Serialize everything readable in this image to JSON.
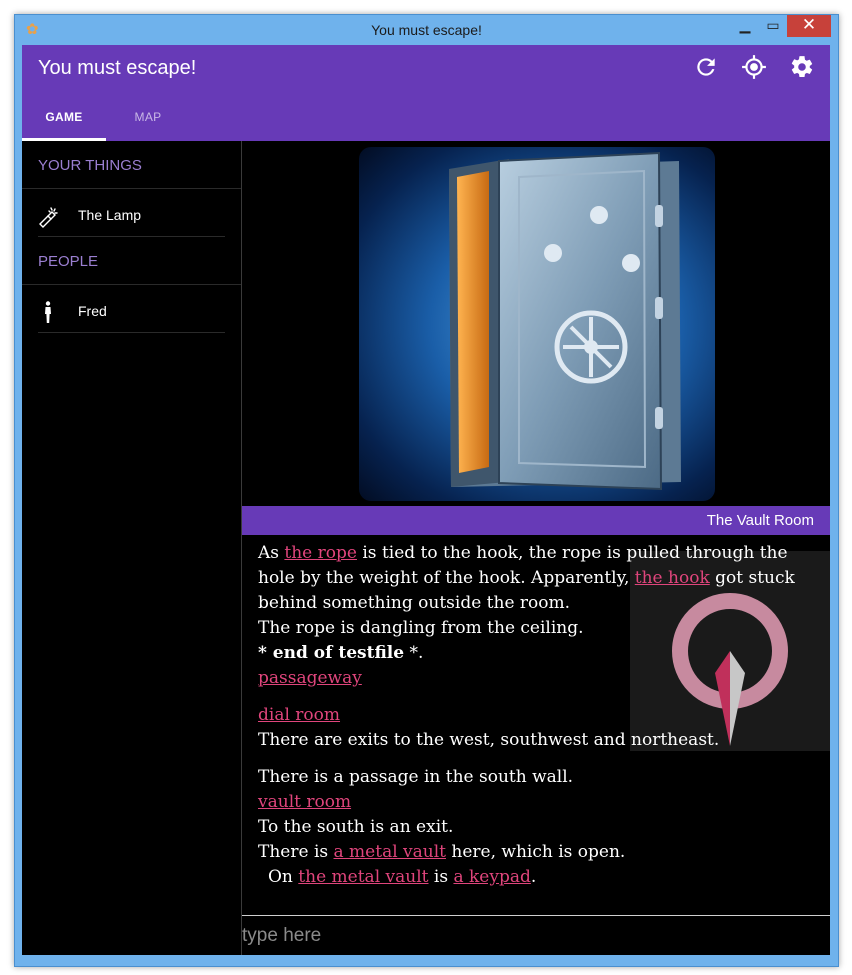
{
  "window": {
    "title": "You must escape!"
  },
  "appbar": {
    "title": "You must escape!"
  },
  "tabs": [
    {
      "label": "GAME"
    },
    {
      "label": "MAP"
    }
  ],
  "sidebar": {
    "things_header": "YOUR THINGS",
    "things": [
      {
        "label": "The Lamp",
        "icon": "flashlight-icon"
      }
    ],
    "people_header": "PEOPLE",
    "people": [
      {
        "label": "Fred",
        "icon": "person-icon"
      }
    ]
  },
  "room": {
    "name": "The Vault Room"
  },
  "story": {
    "p1_pre": "As ",
    "p1_link1": "the rope",
    "p1_mid": " is tied to the hook, the rope is pulled through the hole by the weight of the hook. Apparently, ",
    "p1_link2": "the hook",
    "p1_post": " got stuck behind something outside the room.",
    "line2": "The rope is dangling from the ceiling.",
    "end_bold": "* end of testfile",
    "end_tail": " *.",
    "link_passageway": "passageway",
    "link_dial_room": "dial room",
    "exits_text": "There are exits to the west, southwest and northeast.",
    "passage_text": "There is a passage in the south wall.",
    "link_vault_room": "vault room",
    "south_text": "To the south is an exit.",
    "vault_pre": "There is ",
    "vault_link": "a metal vault",
    "vault_post": " here, which is open.",
    "on_pre": "On ",
    "on_link1": "the metal vault",
    "on_mid": " is ",
    "on_link2": "a keypad",
    "on_post": "."
  },
  "input": {
    "placeholder": "type here"
  },
  "colors": {
    "primary": "#673ab7",
    "link": "#e0457c",
    "background": "#000000"
  }
}
